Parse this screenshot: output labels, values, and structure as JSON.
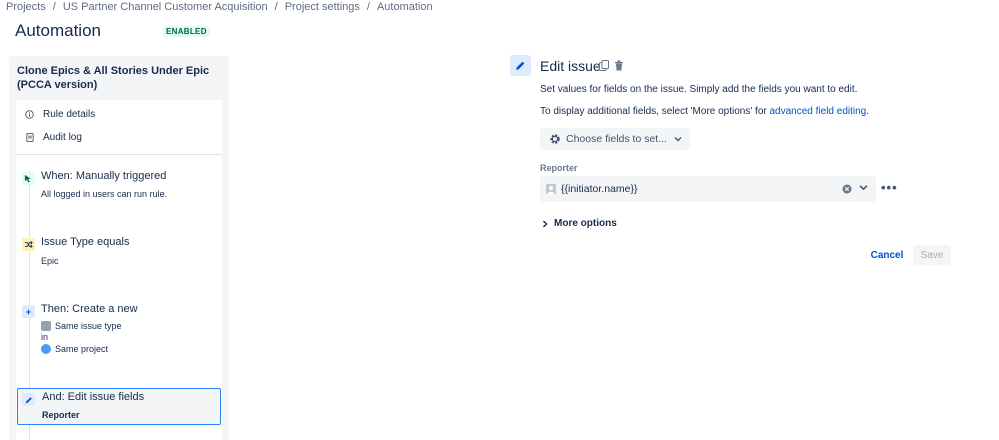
{
  "breadcrumb": [
    "Projects",
    "US Partner Channel Customer Acquisition",
    "Project settings",
    "Automation"
  ],
  "breadcrumb_separator": "/",
  "page": {
    "title": "Automation",
    "status": "ENABLED"
  },
  "rule": {
    "name": "Clone Epics & All Stories Under Epic (PCCA version)",
    "menu": [
      {
        "label": "Rule details",
        "icon": "info-icon"
      },
      {
        "label": "Audit log",
        "icon": "document-icon"
      }
    ],
    "components": {
      "trigger": {
        "title": "When: Manually triggered",
        "desc": "All logged in users can run rule."
      },
      "condition": {
        "title": "Issue Type equals",
        "desc": "Epic"
      },
      "action": {
        "title": "Then: Create a new",
        "line1": "Same issue type",
        "line2": "in",
        "line3": "Same project"
      },
      "edit": {
        "title": "And: Edit issue fields",
        "desc": "Reporter"
      }
    }
  },
  "editor": {
    "title": "Edit issue",
    "desc1": "Set values for fields on the issue. Simply add the fields you want to edit.",
    "desc2_prefix": "To display additional fields, select 'More options' for ",
    "desc2_link": "advanced field editing",
    "desc2_suffix": ".",
    "choose_label": "Choose fields to set...",
    "field_label": "Reporter",
    "field_value": "{{initiator.name}}",
    "more_options": "More options",
    "more_dots": "•••",
    "cancel": "Cancel",
    "save": "Save"
  },
  "colors": {
    "accent": "#0052cc",
    "selected_border": "#2684ff",
    "enabled": "#006644"
  }
}
